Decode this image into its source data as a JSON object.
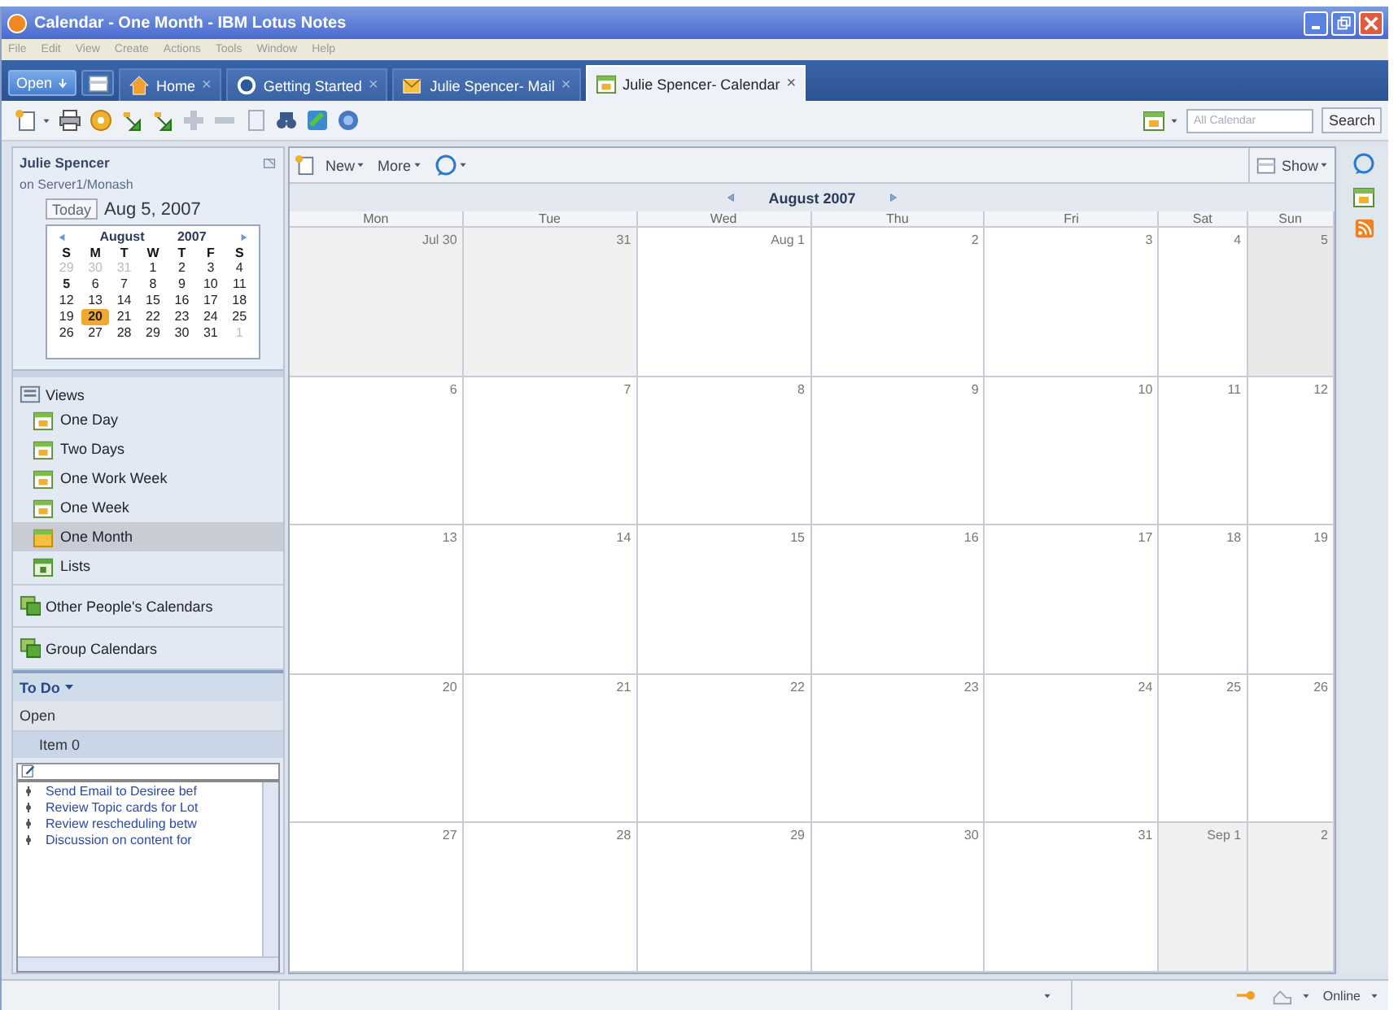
{
  "window": {
    "title": "Calendar - One Month - IBM Lotus Notes"
  },
  "menu": [
    "File",
    "Edit",
    "View",
    "Create",
    "Actions",
    "Tools",
    "Window",
    "Help"
  ],
  "open_button": {
    "label": "Open"
  },
  "tabs": [
    {
      "label": "Home",
      "close": "×",
      "selected": false
    },
    {
      "label": "Getting Started",
      "close": "×",
      "selected": false
    },
    {
      "label": "Julie Spencer- Mail",
      "close": "×",
      "selected": false
    },
    {
      "label": "Julie Spencer- Calendar",
      "close": "×",
      "selected": true
    }
  ],
  "search": {
    "placeholder": "All Calendar",
    "button": "Search"
  },
  "sidebar": {
    "owner": "Julie Spencer",
    "server": "on Server1/Monash",
    "today_button": "Today",
    "today_date": "Aug 5, 2007",
    "mini_calendar": {
      "month": "August",
      "year": "2007",
      "weekdays": [
        "S",
        "M",
        "T",
        "W",
        "T",
        "F",
        "S"
      ],
      "days": [
        {
          "day": "29",
          "outside": true,
          "selected": false,
          "today": false
        },
        {
          "day": "30",
          "outside": true,
          "selected": false,
          "today": false
        },
        {
          "day": "31",
          "outside": true,
          "selected": false,
          "today": false
        },
        {
          "day": "1",
          "outside": false,
          "selected": false,
          "today": false
        },
        {
          "day": "2",
          "outside": false,
          "selected": false,
          "today": false
        },
        {
          "day": "3",
          "outside": false,
          "selected": false,
          "today": false
        },
        {
          "day": "4",
          "outside": false,
          "selected": false,
          "today": false
        },
        {
          "day": "5",
          "outside": false,
          "selected": false,
          "today": true
        },
        {
          "day": "6",
          "outside": false,
          "selected": false,
          "today": false
        },
        {
          "day": "7",
          "outside": false,
          "selected": false,
          "today": false
        },
        {
          "day": "8",
          "outside": false,
          "selected": false,
          "today": false
        },
        {
          "day": "9",
          "outside": false,
          "selected": false,
          "today": false
        },
        {
          "day": "10",
          "outside": false,
          "selected": false,
          "today": false
        },
        {
          "day": "11",
          "outside": false,
          "selected": false,
          "today": false
        },
        {
          "day": "12",
          "outside": false,
          "selected": false,
          "today": false
        },
        {
          "day": "13",
          "outside": false,
          "selected": false,
          "today": false
        },
        {
          "day": "14",
          "outside": false,
          "selected": false,
          "today": false
        },
        {
          "day": "15",
          "outside": false,
          "selected": false,
          "today": false
        },
        {
          "day": "16",
          "outside": false,
          "selected": false,
          "today": false
        },
        {
          "day": "17",
          "outside": false,
          "selected": false,
          "today": false
        },
        {
          "day": "18",
          "outside": false,
          "selected": false,
          "today": false
        },
        {
          "day": "19",
          "outside": false,
          "selected": false,
          "today": false
        },
        {
          "day": "20",
          "outside": false,
          "selected": true,
          "today": false
        },
        {
          "day": "21",
          "outside": false,
          "selected": false,
          "today": false
        },
        {
          "day": "22",
          "outside": false,
          "selected": false,
          "today": false
        },
        {
          "day": "23",
          "outside": false,
          "selected": false,
          "today": false
        },
        {
          "day": "24",
          "outside": false,
          "selected": false,
          "today": false
        },
        {
          "day": "25",
          "outside": false,
          "selected": false,
          "today": false
        },
        {
          "day": "26",
          "outside": false,
          "selected": false,
          "today": false
        },
        {
          "day": "27",
          "outside": false,
          "selected": false,
          "today": false
        },
        {
          "day": "28",
          "outside": false,
          "selected": false,
          "today": false
        },
        {
          "day": "29",
          "outside": false,
          "selected": false,
          "today": false
        },
        {
          "day": "30",
          "outside": false,
          "selected": false,
          "today": false
        },
        {
          "day": "31",
          "outside": false,
          "selected": false,
          "today": false
        },
        {
          "day": "1",
          "outside": true,
          "selected": false,
          "today": false
        }
      ]
    },
    "views_title": "Views",
    "views": [
      {
        "label": "One Day",
        "selected": false
      },
      {
        "label": "Two Days",
        "selected": false
      },
      {
        "label": "One Work Week",
        "selected": false
      },
      {
        "label": "One Week",
        "selected": false
      },
      {
        "label": "One Month",
        "selected": true
      },
      {
        "label": "Lists",
        "selected": false
      }
    ],
    "sections": [
      "Other People's Calendars",
      "Group Calendars"
    ],
    "todo": {
      "title": "To Do",
      "filter": "Open",
      "group": "Item 0",
      "items": [
        "Send Email to Desiree bef",
        "Review Topic cards for Lot",
        "Review rescheduling betw",
        "Discussion on content for"
      ]
    }
  },
  "calendar": {
    "actions": [
      "New",
      "More"
    ],
    "show": "Show",
    "month": "August 2007",
    "weekdays": [
      "Mon",
      "Tue",
      "Wed",
      "Thu",
      "Fri",
      "Sat",
      "Sun"
    ],
    "weeks": [
      [
        {
          "label": "Jul 30",
          "outside": true,
          "today": false
        },
        {
          "label": "31",
          "outside": true,
          "today": false
        },
        {
          "label": "Aug 1",
          "outside": false,
          "today": false
        },
        {
          "label": "2",
          "outside": false,
          "today": false
        },
        {
          "label": "3",
          "outside": false,
          "today": false
        },
        {
          "label": "4",
          "outside": false,
          "today": false
        },
        {
          "label": "5",
          "outside": false,
          "today": true
        }
      ],
      [
        {
          "label": "6",
          "outside": false,
          "today": false
        },
        {
          "label": "7",
          "outside": false,
          "today": false
        },
        {
          "label": "8",
          "outside": false,
          "today": false
        },
        {
          "label": "9",
          "outside": false,
          "today": false
        },
        {
          "label": "10",
          "outside": false,
          "today": false
        },
        {
          "label": "11",
          "outside": false,
          "today": false
        },
        {
          "label": "12",
          "outside": false,
          "today": false
        }
      ],
      [
        {
          "label": "13",
          "outside": false,
          "today": false
        },
        {
          "label": "14",
          "outside": false,
          "today": false
        },
        {
          "label": "15",
          "outside": false,
          "today": false
        },
        {
          "label": "16",
          "outside": false,
          "today": false
        },
        {
          "label": "17",
          "outside": false,
          "today": false
        },
        {
          "label": "18",
          "outside": false,
          "today": false
        },
        {
          "label": "19",
          "outside": false,
          "today": false
        }
      ],
      [
        {
          "label": "20",
          "outside": false,
          "today": false
        },
        {
          "label": "21",
          "outside": false,
          "today": false
        },
        {
          "label": "22",
          "outside": false,
          "today": false
        },
        {
          "label": "23",
          "outside": false,
          "today": false
        },
        {
          "label": "24",
          "outside": false,
          "today": false
        },
        {
          "label": "25",
          "outside": false,
          "today": false
        },
        {
          "label": "26",
          "outside": false,
          "today": false
        }
      ],
      [
        {
          "label": "27",
          "outside": false,
          "today": false
        },
        {
          "label": "28",
          "outside": false,
          "today": false
        },
        {
          "label": "29",
          "outside": false,
          "today": false
        },
        {
          "label": "30",
          "outside": false,
          "today": false
        },
        {
          "label": "31",
          "outside": false,
          "today": false
        },
        {
          "label": "Sep 1",
          "outside": true,
          "today": false
        },
        {
          "label": "2",
          "outside": true,
          "today": false
        }
      ]
    ]
  },
  "status_bar": {
    "connection": "Online"
  }
}
